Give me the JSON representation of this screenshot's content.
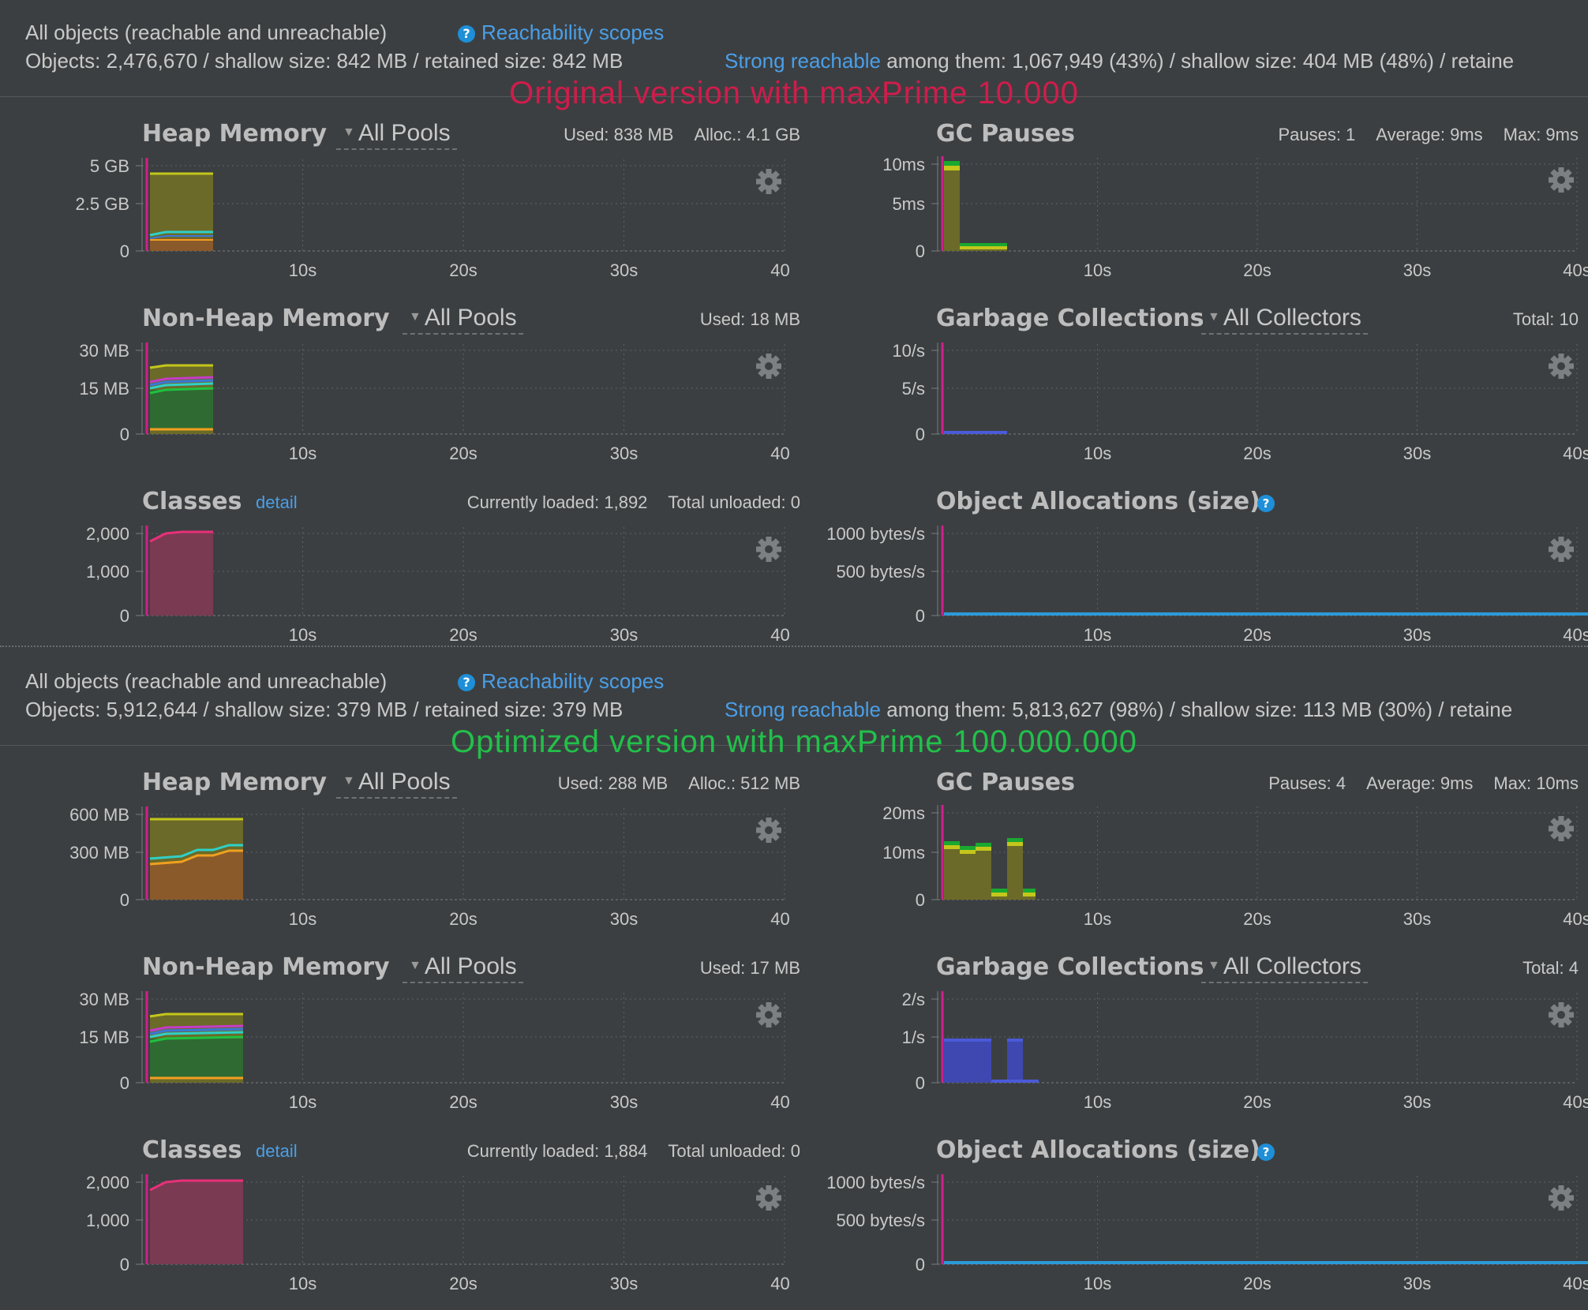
{
  "sections": [
    {
      "summary": {
        "all_objects": "All objects (reachable and unreachable)",
        "reachability_link": "Reachability scopes",
        "objects_line": "Objects: 2,476,670 / shallow size: 842 MB / retained size: 842 MB",
        "strong_link": "Strong reachable",
        "strong_text": " among them: 1,067,949 (43%) / shallow size: 404 MB (48%) / retaine"
      },
      "overlay": {
        "text": "Original version with maxPrime 10.000",
        "color": "#d01c4c"
      },
      "heap": {
        "title": "Heap Memory",
        "pool": "All Pools",
        "used": "Used: 838 MB",
        "alloc": "Alloc.: 4.1 GB",
        "yticks": [
          "5 GB",
          "2.5 GB",
          "0"
        ]
      },
      "gc_pauses": {
        "title": "GC Pauses",
        "pauses": "Pauses: 1",
        "average": "Average: 9ms",
        "max": "Max: 9ms",
        "yticks": [
          "10ms",
          "5ms",
          "0"
        ]
      },
      "nonheap": {
        "title": "Non-Heap Memory",
        "pool": "All Pools",
        "used": "Used: 18 MB",
        "yticks": [
          "30 MB",
          "15 MB",
          "0"
        ]
      },
      "gc": {
        "title": "Garbage Collections",
        "pool": "All Collectors",
        "total": "Total: 10",
        "yticks": [
          "10/s",
          "5/s",
          "0"
        ]
      },
      "classes": {
        "title": "Classes",
        "detail": "detail",
        "loaded": "Currently loaded: 1,892",
        "unloaded": "Total unloaded: 0",
        "yticks": [
          "2,000",
          "1,000",
          "0"
        ]
      },
      "alloc": {
        "title": "Object Allocations (size)",
        "yticks": [
          "1000 bytes/s",
          "500 bytes/s",
          "0"
        ]
      },
      "xticks": [
        "10s",
        "20s",
        "30s",
        "40s"
      ]
    },
    {
      "summary": {
        "all_objects": "All objects (reachable and unreachable)",
        "reachability_link": "Reachability scopes",
        "objects_line": "Objects: 5,912,644 / shallow size: 379 MB / retained size: 379 MB",
        "strong_link": "Strong reachable",
        "strong_text": " among them: 5,813,627 (98%) / shallow size: 113 MB (30%) / retaine"
      },
      "overlay": {
        "text": "Optimized version with maxPrime 100.000.000",
        "color": "#22c04a"
      },
      "heap": {
        "title": "Heap Memory",
        "pool": "All Pools",
        "used": "Used: 288 MB",
        "alloc": "Alloc.: 512 MB",
        "yticks": [
          "600 MB",
          "300 MB",
          "0"
        ]
      },
      "gc_pauses": {
        "title": "GC Pauses",
        "pauses": "Pauses: 4",
        "average": "Average: 9ms",
        "max": "Max: 10ms",
        "yticks": [
          "20ms",
          "10ms",
          "0"
        ]
      },
      "nonheap": {
        "title": "Non-Heap Memory",
        "pool": "All Pools",
        "used": "Used: 17 MB",
        "yticks": [
          "30 MB",
          "15 MB",
          "0"
        ]
      },
      "gc": {
        "title": "Garbage Collections",
        "pool": "All Collectors",
        "total": "Total: 4",
        "yticks": [
          "2/s",
          "1/s",
          "0"
        ]
      },
      "classes": {
        "title": "Classes",
        "detail": "detail",
        "loaded": "Currently loaded: 1,884",
        "unloaded": "Total unloaded: 0",
        "yticks": [
          "2,000",
          "1,000",
          "0"
        ]
      },
      "alloc": {
        "title": "Object Allocations (size)",
        "yticks": [
          "1000 bytes/s",
          "500 bytes/s",
          "0"
        ]
      },
      "xticks": [
        "10s",
        "20s",
        "30s",
        "40s"
      ]
    }
  ],
  "colors": {
    "background": "#3c3f41",
    "link": "#4a9fe8",
    "heap_fill": "#6b6a28",
    "heap_line": "#c4c61c",
    "old_fill": "#8a5a2a",
    "classes_fill": "#7a3a52",
    "classes_line": "#e8307a",
    "gc_bar": "#3f48b0",
    "alloc_bar": "#2c9ad8",
    "marker": "#d0208a"
  }
}
